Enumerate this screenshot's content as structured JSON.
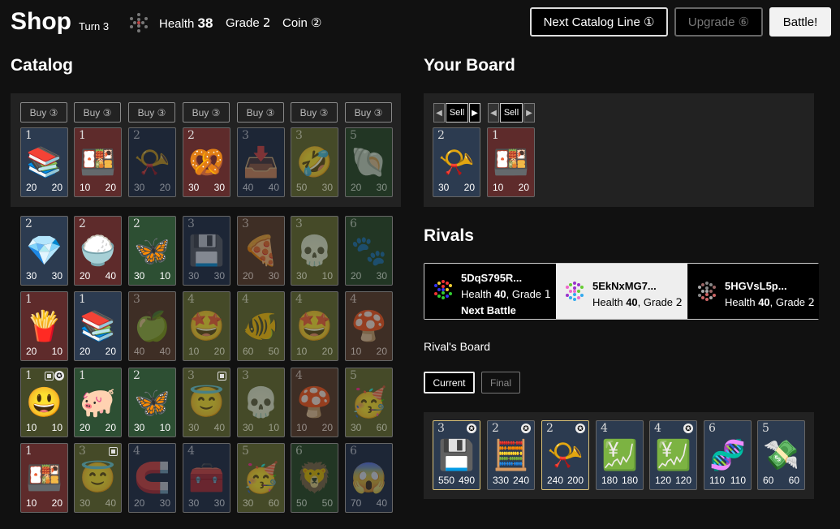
{
  "header": {
    "title": "Shop",
    "turn": "Turn 3",
    "health_label": "Health",
    "health_value": "38",
    "grade_label": "Grade",
    "grade_value": "𝟤",
    "coin_label": "Coin",
    "coin_value": "②",
    "next_catalog_label": "Next Catalog Line ①",
    "upgrade_label": "Upgrade ⑥",
    "battle_label": "Battle!"
  },
  "catalog": {
    "title": "Catalog",
    "buy_labels": [
      "Buy ③",
      "Buy ③",
      "Buy ③",
      "Buy ③",
      "Buy ③",
      "Buy ③",
      "Buy ③"
    ],
    "active_row": [
      {
        "grade": "1",
        "emoji": "📚",
        "attack": "20",
        "health": "20",
        "color": "c-blue"
      },
      {
        "grade": "1",
        "emoji": "🍱",
        "attack": "10",
        "health": "20",
        "color": "c-red"
      },
      {
        "grade": "2",
        "emoji": "📯",
        "attack": "30",
        "health": "20",
        "color": "c-navy",
        "dim": true
      },
      {
        "grade": "2",
        "emoji": "🥨",
        "attack": "30",
        "health": "30",
        "color": "c-red"
      },
      {
        "grade": "3",
        "emoji": "📥",
        "attack": "40",
        "health": "40",
        "color": "c-navy",
        "dim": true
      },
      {
        "grade": "3",
        "emoji": "🤣",
        "attack": "50",
        "health": "30",
        "color": "c-olive",
        "dim": true
      },
      {
        "grade": "5",
        "emoji": "🐚",
        "attack": "20",
        "health": "30",
        "color": "c-dgreen",
        "dim": true
      }
    ],
    "rows": [
      [
        {
          "grade": "2",
          "emoji": "💎",
          "attack": "30",
          "health": "30",
          "color": "c-blue"
        },
        {
          "grade": "2",
          "emoji": "🍚",
          "attack": "20",
          "health": "40",
          "color": "c-red"
        },
        {
          "grade": "2",
          "emoji": "🦋",
          "attack": "30",
          "health": "10",
          "color": "c-green"
        },
        {
          "grade": "3",
          "emoji": "💾",
          "attack": "30",
          "health": "30",
          "color": "c-navy",
          "dim": true
        },
        {
          "grade": "3",
          "emoji": "🍕",
          "attack": "20",
          "health": "30",
          "color": "c-brown",
          "dim": true
        },
        {
          "grade": "3",
          "emoji": "💀",
          "attack": "30",
          "health": "10",
          "color": "c-olive",
          "dim": true
        },
        {
          "grade": "6",
          "emoji": "🐾",
          "attack": "20",
          "health": "30",
          "color": "c-dgreen",
          "dim": true
        }
      ],
      [
        {
          "grade": "1",
          "emoji": "🍟",
          "attack": "20",
          "health": "10",
          "color": "c-red"
        },
        {
          "grade": "1",
          "emoji": "📚",
          "attack": "20",
          "health": "20",
          "color": "c-blue"
        },
        {
          "grade": "3",
          "emoji": "🍏",
          "attack": "40",
          "health": "40",
          "color": "c-brown",
          "dim": true
        },
        {
          "grade": "4",
          "emoji": "🤩",
          "attack": "10",
          "health": "20",
          "color": "c-olive",
          "dim": true
        },
        {
          "grade": "4",
          "emoji": "🐠",
          "attack": "60",
          "health": "50",
          "color": "c-olive",
          "dim": true
        },
        {
          "grade": "4",
          "emoji": "🤩",
          "attack": "10",
          "health": "20",
          "color": "c-olive",
          "dim": true
        },
        {
          "grade": "4",
          "emoji": "🍄",
          "attack": "10",
          "health": "20",
          "color": "c-brown",
          "dim": true
        }
      ],
      [
        {
          "grade": "1",
          "emoji": "😃",
          "attack": "10",
          "health": "10",
          "color": "c-olive",
          "badges": true
        },
        {
          "grade": "1",
          "emoji": "🐖",
          "attack": "20",
          "health": "20",
          "color": "c-green"
        },
        {
          "grade": "2",
          "emoji": "🦋",
          "attack": "30",
          "health": "10",
          "color": "c-green"
        },
        {
          "grade": "3",
          "emoji": "😇",
          "attack": "30",
          "health": "40",
          "color": "c-olive",
          "dim": true,
          "tag": true
        },
        {
          "grade": "3",
          "emoji": "💀",
          "attack": "30",
          "health": "10",
          "color": "c-olive",
          "dim": true
        },
        {
          "grade": "4",
          "emoji": "🍄",
          "attack": "10",
          "health": "20",
          "color": "c-brown",
          "dim": true
        },
        {
          "grade": "5",
          "emoji": "🥳",
          "attack": "30",
          "health": "60",
          "color": "c-olive",
          "dim": true
        }
      ],
      [
        {
          "grade": "1",
          "emoji": "🍱",
          "attack": "10",
          "health": "20",
          "color": "c-red"
        },
        {
          "grade": "3",
          "emoji": "😇",
          "attack": "30",
          "health": "40",
          "color": "c-olive",
          "dim": true,
          "tag": true
        },
        {
          "grade": "4",
          "emoji": "🧲",
          "attack": "20",
          "health": "30",
          "color": "c-navy",
          "dim": true
        },
        {
          "grade": "4",
          "emoji": "🧰",
          "attack": "30",
          "health": "30",
          "color": "c-navy",
          "dim": true
        },
        {
          "grade": "5",
          "emoji": "🥳",
          "attack": "30",
          "health": "60",
          "color": "c-olive",
          "dim": true
        },
        {
          "grade": "6",
          "emoji": "🦁",
          "attack": "50",
          "health": "50",
          "color": "c-dgreen",
          "dim": true
        },
        {
          "grade": "6",
          "emoji": "😱",
          "attack": "70",
          "health": "40",
          "color": "c-navy",
          "dim": true
        }
      ]
    ]
  },
  "board": {
    "title": "Your Board",
    "sell_label": "Sell",
    "cards": [
      {
        "grade": "2",
        "emoji": "📯",
        "attack": "30",
        "health": "20",
        "color": "c-blue"
      },
      {
        "grade": "1",
        "emoji": "🍱",
        "attack": "10",
        "health": "20",
        "color": "c-red"
      }
    ]
  },
  "rivals": {
    "title": "Rivals",
    "list": [
      {
        "name": "5DqS795R...",
        "health_label": "Health",
        "health": "40",
        "grade_label": "Grade",
        "grade": "𝟣",
        "next": "Next Battle"
      },
      {
        "name": "5EkNxMG7...",
        "health_label": "Health",
        "health": "40",
        "grade_label": "Grade",
        "grade": "𝟤"
      },
      {
        "name": "5HGVsL5p...",
        "health_label": "Health",
        "health": "40",
        "grade_label": "Grade",
        "grade": "𝟤"
      }
    ],
    "board_title": "Rival's Board",
    "tab_current": "Current",
    "tab_final": "Final",
    "cards": [
      {
        "grade": "3",
        "emoji": "💾",
        "attack": "550",
        "health": "490",
        "color": "c-blue",
        "star": true,
        "sel": true
      },
      {
        "grade": "2",
        "emoji": "🧮",
        "attack": "330",
        "health": "240",
        "color": "c-blue",
        "star": true
      },
      {
        "grade": "2",
        "emoji": "📯",
        "attack": "240",
        "health": "200",
        "color": "c-blue",
        "star": true,
        "sel": true
      },
      {
        "grade": "4",
        "emoji": "💹",
        "attack": "180",
        "health": "180",
        "color": "c-blue"
      },
      {
        "grade": "4",
        "emoji": "💹",
        "attack": "120",
        "health": "120",
        "color": "c-blue",
        "star": true
      },
      {
        "grade": "6",
        "emoji": "🧬",
        "attack": "110",
        "health": "110",
        "color": "c-blue"
      },
      {
        "grade": "5",
        "emoji": "💸",
        "attack": "60",
        "health": "60",
        "color": "c-blue"
      }
    ]
  }
}
